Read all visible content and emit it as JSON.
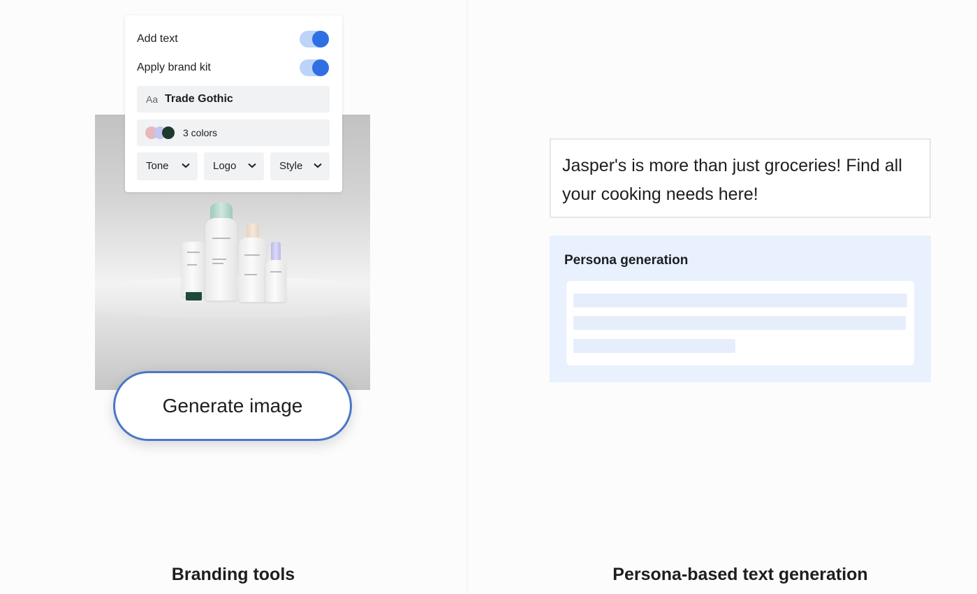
{
  "branding": {
    "add_text_label": "Add text",
    "add_text_on": true,
    "apply_brand_kit_label": "Apply brand kit",
    "apply_brand_kit_on": true,
    "font_prefix": "Aa",
    "font_name": "Trade Gothic",
    "colors_label": "3 colors",
    "swatch_colors": [
      "#e6b8bb",
      "#c3c6f0",
      "#1d3a2c"
    ],
    "dropdowns": [
      "Tone",
      "Logo",
      "Style"
    ],
    "generate_button": "Generate image",
    "caption": "Branding tools"
  },
  "persona": {
    "generated_text": "Jasper's is more than just groceries! Find all your cooking needs here!",
    "card_title": "Persona generation",
    "caption": "Persona-based text generation"
  },
  "colors": {
    "accent": "#2f6fe4",
    "button_border": "#4b76c8",
    "persona_bg": "#e8f1fd"
  }
}
